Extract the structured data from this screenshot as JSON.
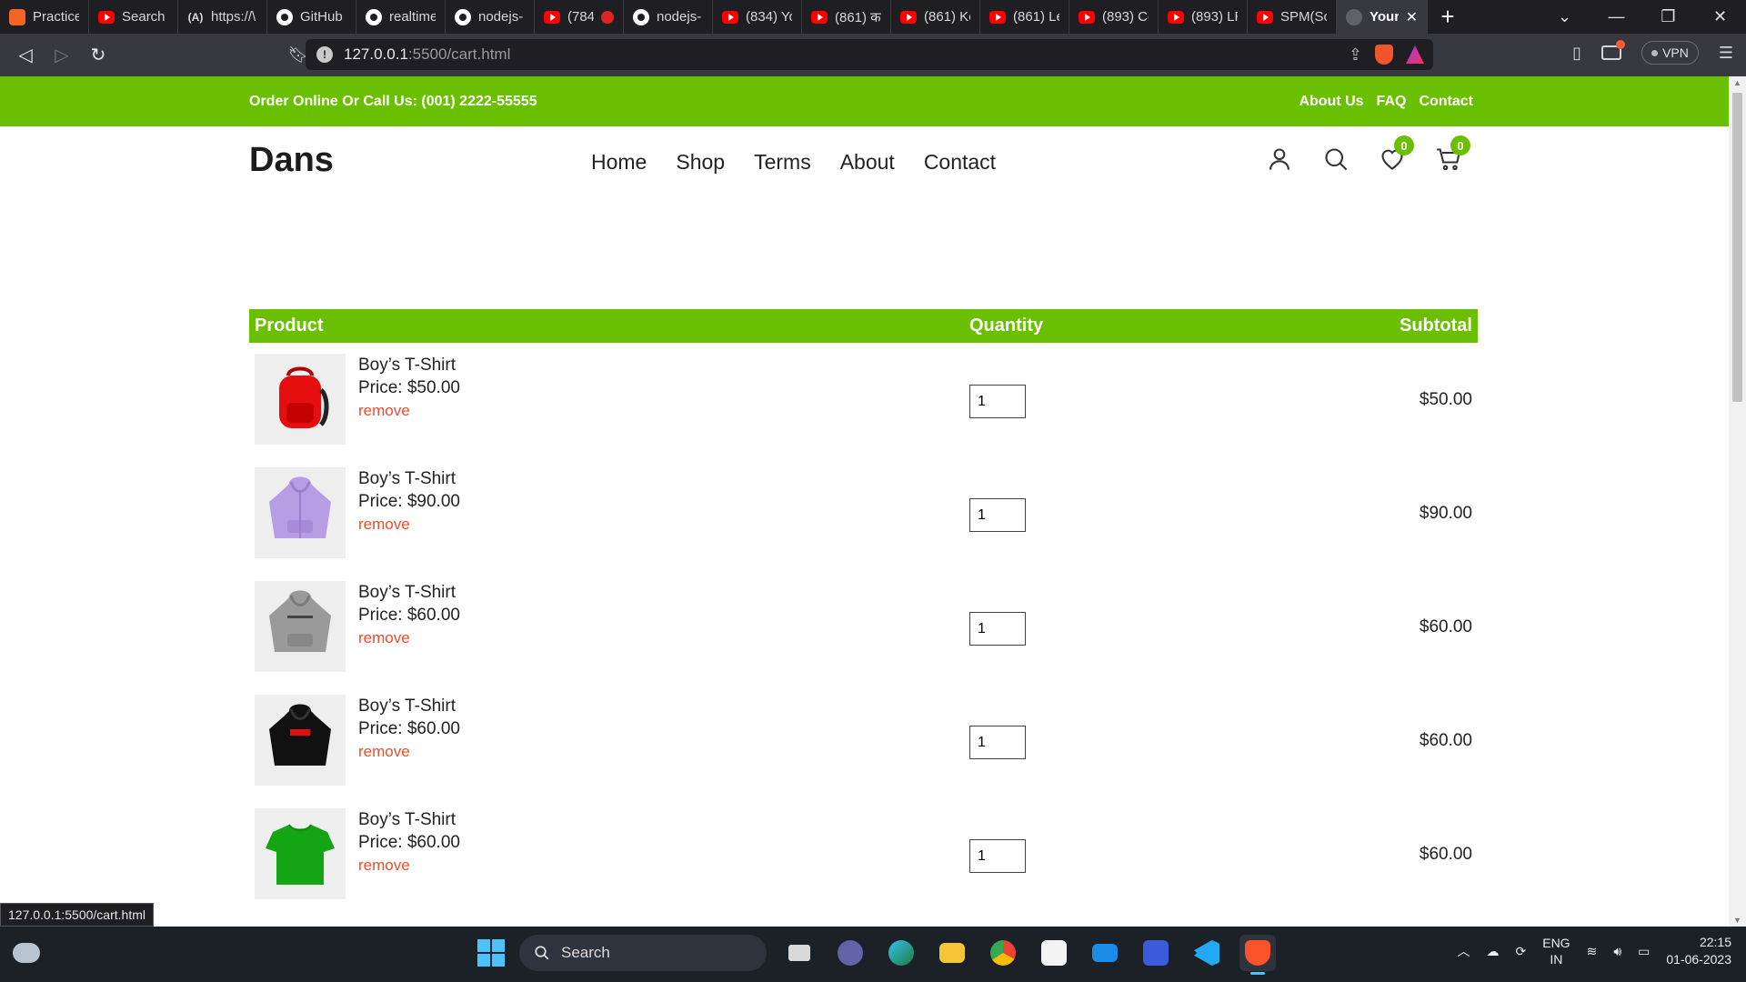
{
  "browser": {
    "tabs": [
      {
        "label": "Practice",
        "icon": "codecademy-icon"
      },
      {
        "label": "Search I",
        "icon": "youtube-icon"
      },
      {
        "label": "https://\\",
        "icon": "text-icon"
      },
      {
        "label": "GitHub",
        "icon": "github-icon"
      },
      {
        "label": "realtime",
        "icon": "github-icon"
      },
      {
        "label": "nodejs-",
        "icon": "github-icon"
      },
      {
        "label": "(784)",
        "icon": "youtube-icon"
      },
      {
        "label": "nodejs-",
        "icon": "github-icon"
      },
      {
        "label": "(834) Yo",
        "icon": "youtube-icon"
      },
      {
        "label": "(861) क",
        "icon": "youtube-icon"
      },
      {
        "label": "(861) Ke",
        "icon": "youtube-icon"
      },
      {
        "label": "(861) Le",
        "icon": "youtube-icon"
      },
      {
        "label": "(893) Co",
        "icon": "youtube-icon"
      },
      {
        "label": "(893) LR",
        "icon": "youtube-icon"
      },
      {
        "label": "SPM(So",
        "icon": "youtube-icon"
      }
    ],
    "active_tab": {
      "label": "Your",
      "icon": "globe-icon"
    },
    "text_tab_icon": "(A)",
    "url_host": "127.0.0.1",
    "url_path": ":5500/cart.html",
    "vpn_label": "VPN",
    "rewards_count": "1",
    "status_url": "127.0.0.1:5500/cart.html"
  },
  "site": {
    "topbar": {
      "phone_text": "Order Online Or Call Us: (001) 2222-55555",
      "links": [
        "About Us",
        "FAQ",
        "Contact"
      ]
    },
    "logo": "Dans",
    "nav": [
      "Home",
      "Shop",
      "Terms",
      "About",
      "Contact"
    ],
    "wishlist_count": "0",
    "cart_count": "0",
    "accent_color": "#6ac000",
    "remove_color": "#f04b2b"
  },
  "cart": {
    "headers": {
      "product": "Product",
      "quantity": "Quantity",
      "subtotal": "Subtotal"
    },
    "items": [
      {
        "name": "Boy’s T-Shirt",
        "price": "Price: $50.00",
        "remove": "remove",
        "quantity": "1",
        "subtotal": "$50.00",
        "image": "red-backpack"
      },
      {
        "name": "Boy’s T-Shirt",
        "price": "Price: $90.00",
        "remove": "remove",
        "quantity": "1",
        "subtotal": "$90.00",
        "image": "purple-hoodie"
      },
      {
        "name": "Boy’s T-Shirt",
        "price": "Price: $60.00",
        "remove": "remove",
        "quantity": "1",
        "subtotal": "$60.00",
        "image": "grey-hoodie"
      },
      {
        "name": "Boy’s T-Shirt",
        "price": "Price: $60.00",
        "remove": "remove",
        "quantity": "1",
        "subtotal": "$60.00",
        "image": "black-hoodie"
      },
      {
        "name": "Boy’s T-Shirt",
        "price": "Price: $60.00",
        "remove": "remove",
        "quantity": "1",
        "subtotal": "$60.00",
        "image": "green-tshirt"
      }
    ]
  },
  "taskbar": {
    "search_label": "Search",
    "lang_top": "ENG",
    "lang_bottom": "IN",
    "time": "22:15",
    "date": "01-06-2023"
  }
}
